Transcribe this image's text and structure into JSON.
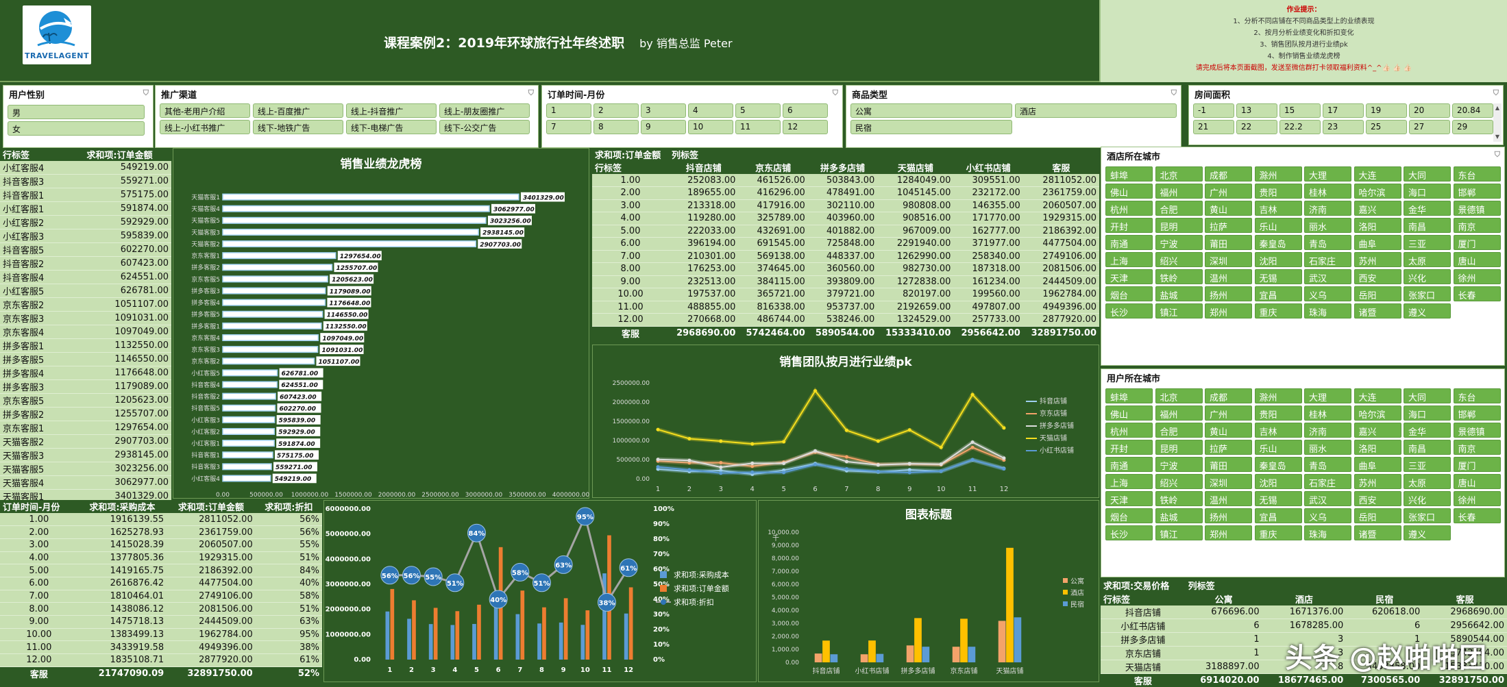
{
  "header": {
    "logo_text": "TRAVELAGENT",
    "title": "课程案例2：2019年环球旅行社年终述职",
    "byline": "by  销售总监 Peter"
  },
  "notes": {
    "heading": "作业提示：",
    "items": [
      "1、分析不同店铺在不同商品类型上的业绩表现",
      "2、按月分析业绩变化和折扣变化",
      "3、销售团队按月进行业绩pk",
      "4、制作销售业绩龙虎榜"
    ],
    "footer": "请完成后将本页面截图，发送至微信群打卡领取福利资料^_^👍🏻 👍🏻 👍🏻"
  },
  "slicers": {
    "gender": {
      "title": "用户性别",
      "items": [
        "男",
        "女"
      ]
    },
    "channel": {
      "title": "推广渠道",
      "items": [
        "其他-老用户介绍",
        "线上-百度推广",
        "线上-抖音推广",
        "线上-朋友圈推广",
        "线上-小红书推广",
        "线下-地铁广告",
        "线下-电梯广告",
        "线下-公交广告"
      ]
    },
    "month": {
      "title": "订单时间-月份",
      "items": [
        "1",
        "2",
        "3",
        "4",
        "5",
        "6",
        "7",
        "8",
        "9",
        "10",
        "11",
        "12"
      ]
    },
    "product": {
      "title": "商品类型",
      "items": [
        "公寓",
        "酒店",
        "民宿"
      ]
    },
    "room": {
      "title": "房间面积",
      "items": [
        "-1",
        "13",
        "15",
        "17",
        "19",
        "20",
        "20.84",
        "21",
        "22",
        "22.2",
        "23",
        "25",
        "27",
        "29"
      ]
    },
    "hotel_city": {
      "title": "酒店所在城市",
      "items": [
        "蚌埠",
        "北京",
        "成都",
        "滁州",
        "大理",
        "大连",
        "大同",
        "东台",
        "佛山",
        "福州",
        "广州",
        "贵阳",
        "桂林",
        "哈尔滨",
        "海口",
        "邯郸",
        "杭州",
        "合肥",
        "黄山",
        "吉林",
        "济南",
        "嘉兴",
        "金华",
        "景德镇",
        "开封",
        "昆明",
        "拉萨",
        "乐山",
        "丽水",
        "洛阳",
        "南昌",
        "南京",
        "南通",
        "宁波",
        "莆田",
        "秦皇岛",
        "青岛",
        "曲阜",
        "三亚",
        "厦门",
        "上海",
        "绍兴",
        "深圳",
        "沈阳",
        "石家庄",
        "苏州",
        "太原",
        "唐山",
        "天津",
        "铁岭",
        "温州",
        "无锡",
        "武汉",
        "西安",
        "兴化",
        "徐州",
        "烟台",
        "盐城",
        "扬州",
        "宜昌",
        "义乌",
        "岳阳",
        "张家口",
        "长春",
        "长沙",
        "镇江",
        "郑州",
        "重庆",
        "珠海",
        "诸暨",
        "遵义"
      ]
    },
    "user_city": {
      "title": "用户所在城市",
      "items": [
        "蚌埠",
        "北京",
        "成都",
        "滁州",
        "大理",
        "大连",
        "大同",
        "东台",
        "佛山",
        "福州",
        "广州",
        "贵阳",
        "桂林",
        "哈尔滨",
        "海口",
        "邯郸",
        "杭州",
        "合肥",
        "黄山",
        "吉林",
        "济南",
        "嘉兴",
        "金华",
        "景德镇",
        "开封",
        "昆明",
        "拉萨",
        "乐山",
        "丽水",
        "洛阳",
        "南昌",
        "南京",
        "南通",
        "宁波",
        "莆田",
        "秦皇岛",
        "青岛",
        "曲阜",
        "三亚",
        "厦门",
        "上海",
        "绍兴",
        "深圳",
        "沈阳",
        "石家庄",
        "苏州",
        "太原",
        "唐山",
        "天津",
        "铁岭",
        "温州",
        "无锡",
        "武汉",
        "西安",
        "兴化",
        "徐州",
        "烟台",
        "盐城",
        "扬州",
        "宜昌",
        "义乌",
        "岳阳",
        "张家口",
        "长春",
        "长沙",
        "镇江",
        "郑州",
        "重庆",
        "珠海",
        "诸暨",
        "遵义"
      ]
    }
  },
  "rank_table": {
    "headers": [
      "行标签",
      "求和项:订单金额"
    ],
    "rows": [
      [
        "小红客服4",
        "549219.00"
      ],
      [
        "抖音客服3",
        "559271.00"
      ],
      [
        "抖音客服1",
        "575175.00"
      ],
      [
        "小红客服1",
        "591874.00"
      ],
      [
        "小红客服2",
        "592929.00"
      ],
      [
        "小红客服3",
        "595839.00"
      ],
      [
        "抖音客服5",
        "602270.00"
      ],
      [
        "抖音客服2",
        "607423.00"
      ],
      [
        "抖音客服4",
        "624551.00"
      ],
      [
        "小红客服5",
        "626781.00"
      ],
      [
        "京东客服2",
        "1051107.00"
      ],
      [
        "京东客服3",
        "1091031.00"
      ],
      [
        "京东客服4",
        "1097049.00"
      ],
      [
        "拼多客服1",
        "1132550.00"
      ],
      [
        "拼多客服5",
        "1146550.00"
      ],
      [
        "拼多客服4",
        "1176648.00"
      ],
      [
        "拼多客服3",
        "1179089.00"
      ],
      [
        "京东客服5",
        "1205623.00"
      ],
      [
        "拼多客服2",
        "1255707.00"
      ],
      [
        "京东客服1",
        "1297654.00"
      ],
      [
        "天猫客服2",
        "2907703.00"
      ],
      [
        "天猫客服3",
        "2938145.00"
      ],
      [
        "天猫客服5",
        "3023256.00"
      ],
      [
        "天猫客服4",
        "3062977.00"
      ],
      [
        "天猫客服1",
        "3401329.00"
      ]
    ],
    "total": [
      "客服",
      "32891750.00"
    ]
  },
  "store_table": {
    "corner": "求和项:订单金额",
    "col_label": "列标签",
    "headers": [
      "行标签",
      "抖音店铺",
      "京东店铺",
      "拼多多店铺",
      "天猫店铺",
      "小红书店铺",
      "客服"
    ],
    "rows": [
      [
        "1.00",
        "252083.00",
        "461526.00",
        "503843.00",
        "1284049.00",
        "309551.00",
        "2811052.00"
      ],
      [
        "2.00",
        "189655.00",
        "416296.00",
        "478491.00",
        "1045145.00",
        "232172.00",
        "2361759.00"
      ],
      [
        "3.00",
        "213318.00",
        "417916.00",
        "302110.00",
        "980808.00",
        "146355.00",
        "2060507.00"
      ],
      [
        "4.00",
        "119280.00",
        "325789.00",
        "403960.00",
        "908516.00",
        "171770.00",
        "1929315.00"
      ],
      [
        "5.00",
        "222033.00",
        "432691.00",
        "401882.00",
        "967009.00",
        "162777.00",
        "2186392.00"
      ],
      [
        "6.00",
        "396194.00",
        "691545.00",
        "725848.00",
        "2291940.00",
        "371977.00",
        "4477504.00"
      ],
      [
        "7.00",
        "210301.00",
        "569138.00",
        "448337.00",
        "1262990.00",
        "258340.00",
        "2749106.00"
      ],
      [
        "8.00",
        "176253.00",
        "374645.00",
        "360560.00",
        "982730.00",
        "187318.00",
        "2081506.00"
      ],
      [
        "9.00",
        "232513.00",
        "384115.00",
        "393809.00",
        "1272838.00",
        "161234.00",
        "2444509.00"
      ],
      [
        "10.00",
        "197537.00",
        "365721.00",
        "379721.00",
        "820197.00",
        "199560.00",
        "1962784.00"
      ],
      [
        "11.00",
        "488855.00",
        "816338.00",
        "953737.00",
        "2192659.00",
        "497807.00",
        "4949396.00"
      ],
      [
        "12.00",
        "270668.00",
        "486744.00",
        "538246.00",
        "1324529.00",
        "257733.00",
        "2877920.00"
      ]
    ],
    "total": [
      "客服",
      "2968690.00",
      "5742464.00",
      "5890544.00",
      "15333410.00",
      "2956642.00",
      "32891750.00"
    ]
  },
  "month_table": {
    "headers": [
      "订单时间-月份",
      "求和项:采购成本",
      "求和项:订单金额",
      "求和项:折扣"
    ],
    "rows": [
      [
        "1.00",
        "1916139.55",
        "2811052.00",
        "56%"
      ],
      [
        "2.00",
        "1625278.93",
        "2361759.00",
        "56%"
      ],
      [
        "3.00",
        "1415028.39",
        "2060507.00",
        "55%"
      ],
      [
        "4.00",
        "1377805.36",
        "1929315.00",
        "51%"
      ],
      [
        "5.00",
        "1419165.75",
        "2186392.00",
        "84%"
      ],
      [
        "6.00",
        "2616876.42",
        "4477504.00",
        "40%"
      ],
      [
        "7.00",
        "1810464.01",
        "2749106.00",
        "58%"
      ],
      [
        "8.00",
        "1438086.12",
        "2081506.00",
        "51%"
      ],
      [
        "9.00",
        "1475718.13",
        "2444509.00",
        "63%"
      ],
      [
        "10.00",
        "1383499.13",
        "1962784.00",
        "95%"
      ],
      [
        "11.00",
        "3433919.58",
        "4949396.00",
        "38%"
      ],
      [
        "12.00",
        "1835108.71",
        "2877920.00",
        "61%"
      ]
    ],
    "total": [
      "客服",
      "21747090.09",
      "32891750.00",
      "52%"
    ]
  },
  "price_table": {
    "corner": "求和项:交易价格",
    "col_label": "列标签",
    "headers": [
      "行标签",
      "公寓",
      "酒店",
      "民宿",
      "客服"
    ],
    "rows": [
      [
        "抖音店铺",
        "676696.00",
        "1671376.00",
        "620618.00",
        "2968690.00"
      ],
      [
        "小红书店铺",
        "6",
        "1678285.00",
        "6",
        "2956642.00"
      ],
      [
        "拼多多店铺",
        "1",
        "3",
        "1",
        "5890544.00"
      ],
      [
        "京东店铺",
        "1",
        "3",
        "1",
        "5742464.00"
      ],
      [
        "天猫店铺",
        "3188897.00",
        "8",
        "3458358.00",
        "15333410.00"
      ]
    ],
    "total": [
      "客服",
      "6914020.00",
      "18677465.00",
      "7300565.00",
      "32891750.00"
    ]
  },
  "chart_data": [
    {
      "type": "bar",
      "title": "销售业绩龙虎榜",
      "orientation": "horizontal",
      "categories": [
        "天猫客服1",
        "天猫客服4",
        "天猫客服5",
        "天猫客服3",
        "天猫客服2",
        "京东客服1",
        "拼多客服2",
        "京东客服5",
        "拼多客服3",
        "拼多客服4",
        "拼多客服5",
        "拼多客服1",
        "京东客服4",
        "京东客服3",
        "京东客服2",
        "小红客服5",
        "抖音客服4",
        "抖音客服2",
        "抖音客服5",
        "小红客服3",
        "小红客服2",
        "小红客服1",
        "抖音客服1",
        "抖音客服3",
        "小红客服4"
      ],
      "values": [
        3401329,
        3062977,
        3023256,
        2938145,
        2907703,
        1297654,
        1255707,
        1205623,
        1179089,
        1176648,
        1146550,
        1132550,
        1097049,
        1091031,
        1051107,
        626781,
        624551,
        607423,
        602270,
        595839,
        592929,
        591874,
        575175,
        559271,
        549219
      ],
      "data_labels": [
        "3401329.00",
        "3062977.00",
        "3023256.00",
        "2938145.00",
        "2907703.00",
        "1297654.00",
        "1255707.00",
        "1205623.00",
        "1179089.00",
        "1176648.00",
        "1146550.00",
        "1132550.00",
        "1097049.00",
        "1091031.00",
        "1051107.00",
        "626781.00",
        "624551.00",
        "607423.00",
        "602270.00",
        "595839.00",
        "592929.00",
        "591874.00",
        "575175.00",
        "559271.00",
        "549219.00"
      ],
      "xlim": [
        0,
        4000000
      ],
      "ticks": [
        "0.00",
        "500000.00",
        "1000000.00",
        "1500000.00",
        "2000000.00",
        "2500000.00",
        "3000000.00",
        "3500000.00",
        "4000000.00"
      ]
    },
    {
      "type": "line",
      "title": "销售团队按月进行业绩pk",
      "x": [
        "1",
        "2",
        "3",
        "4",
        "5",
        "6",
        "7",
        "8",
        "9",
        "10",
        "11",
        "12"
      ],
      "ylim": [
        0,
        2500000
      ],
      "ticks": [
        "0.00",
        "500000.00",
        "1000000.00",
        "1500000.00",
        "2000000.00",
        "2500000.00"
      ],
      "series": [
        {
          "name": "抖音店铺",
          "color": "#9fd0f0",
          "values": [
            252083,
            189655,
            213318,
            119280,
            222033,
            396194,
            210301,
            176253,
            232513,
            197537,
            488855,
            270668
          ]
        },
        {
          "name": "京东店铺",
          "color": "#f4a36a",
          "values": [
            461526,
            416296,
            417916,
            325789,
            432691,
            691545,
            569138,
            374645,
            384115,
            365721,
            816338,
            486744
          ]
        },
        {
          "name": "拼多多店铺",
          "color": "#dddddd",
          "values": [
            503843,
            478491,
            302110,
            403960,
            401882,
            725848,
            448337,
            360560,
            393809,
            379721,
            953737,
            538246
          ]
        },
        {
          "name": "天猫店铺",
          "color": "#f7df1e",
          "values": [
            1284049,
            1045145,
            980808,
            908516,
            967009,
            2291940,
            1262990,
            982730,
            1272838,
            820197,
            2192659,
            1324529
          ]
        },
        {
          "name": "小红书店铺",
          "color": "#5b9bd5",
          "values": [
            309551,
            232172,
            146355,
            171770,
            162777,
            371977,
            258340,
            187318,
            161234,
            199560,
            497807,
            257733
          ]
        }
      ]
    },
    {
      "type": "bar",
      "title": "",
      "x": [
        "1",
        "2",
        "3",
        "4",
        "5",
        "6",
        "7",
        "8",
        "9",
        "10",
        "11",
        "12"
      ],
      "ylim": [
        0,
        6000000
      ],
      "ticks": [
        "0.00",
        "1000000.00",
        "2000000.00",
        "3000000.00",
        "4000000.00",
        "5000000.00",
        "6000000.00"
      ],
      "y2lim": [
        0,
        1
      ],
      "y2ticks": [
        "0%",
        "10%",
        "20%",
        "30%",
        "40%",
        "50%",
        "60%",
        "70%",
        "80%",
        "90%",
        "100%"
      ],
      "series": [
        {
          "name": "求和项:采购成本",
          "type": "bar",
          "color": "#5b9bd5",
          "values": [
            1916139.55,
            1625278.93,
            1415028.39,
            1377805.36,
            1419165.75,
            2616876.42,
            1810464.01,
            1438086.12,
            1475718.13,
            1383499.13,
            3433919.58,
            1835108.71
          ]
        },
        {
          "name": "求和项:订单金额",
          "type": "bar",
          "color": "#ed7d31",
          "values": [
            2811052,
            2361759,
            2060507,
            1929315,
            2186392,
            4477504,
            2749106,
            2081506,
            2444509,
            1962784,
            4949396,
            2877920
          ]
        },
        {
          "name": "求和项:折扣",
          "type": "line",
          "color": "#a5a5a5",
          "values": [
            0.56,
            0.56,
            0.55,
            0.51,
            0.84,
            0.4,
            0.58,
            0.51,
            0.63,
            0.95,
            0.38,
            0.61
          ],
          "labels": [
            "56%",
            "56%",
            "55%",
            "51%",
            "84%",
            "40%",
            "58%",
            "51%",
            "63%",
            "95%",
            "38%",
            "61%"
          ]
        }
      ]
    },
    {
      "type": "bar",
      "title": "图表标题",
      "ylabel": "千",
      "categories": [
        "抖音店铺",
        "小红书店铺",
        "拼多多店铺",
        "京东店铺",
        "天猫店铺"
      ],
      "ylim": [
        0,
        10000
      ],
      "ticks": [
        "0.00",
        "1,000.00",
        "2,000.00",
        "3,000.00",
        "4,000.00",
        "5,000.00",
        "6,000.00",
        "7,000.00",
        "8,000.00",
        "9,000.00",
        "10,000.00"
      ],
      "series": [
        {
          "name": "公寓",
          "color": "#f4a36a",
          "values": [
            676.696,
            620,
            1300,
            1200,
            3188.897
          ]
        },
        {
          "name": "酒店",
          "color": "#ffc000",
          "values": [
            1671.376,
            1678.285,
            3400,
            3350,
            8800
          ]
        },
        {
          "name": "民宿",
          "color": "#5b9bd5",
          "values": [
            620.618,
            650,
            1200,
            1200,
            3458.358
          ]
        }
      ]
    }
  ],
  "watermark": "头条 @赵啪啪团"
}
